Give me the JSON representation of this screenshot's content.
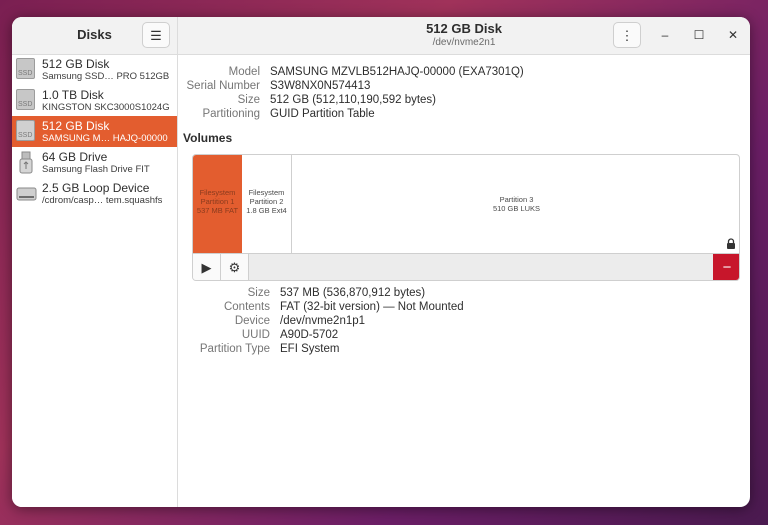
{
  "sidebar": {
    "title": "Disks",
    "devices": [
      {
        "name": "512 GB Disk",
        "sub": "Samsung SSD… PRO 512GB",
        "icon": "ssd-icon",
        "selected": false
      },
      {
        "name": "1.0 TB Disk",
        "sub": "KINGSTON SKC3000S1024G",
        "icon": "ssd-icon",
        "selected": false
      },
      {
        "name": "512 GB Disk",
        "sub": "SAMSUNG M… HAJQ-00000",
        "icon": "ssd-icon",
        "selected": true
      },
      {
        "name": "64 GB Drive",
        "sub": "Samsung Flash Drive FIT",
        "icon": "usb-drive-icon",
        "selected": false
      },
      {
        "name": "2.5 GB Loop Device",
        "sub": "/cdrom/casp… tem.squashfs",
        "icon": "loop-device-icon",
        "selected": false
      }
    ],
    "ssd_label": "SSD"
  },
  "header": {
    "title": "512 GB Disk",
    "subtitle": "/dev/nvme2n1"
  },
  "disk_info": {
    "model_label": "Model",
    "model": "SAMSUNG MZVLB512HAJQ-00000 (EXA7301Q)",
    "serial_label": "Serial Number",
    "serial": "S3W8NX0N574413",
    "size_label": "Size",
    "size": "512 GB (512,110,190,592 bytes)",
    "partitioning_label": "Partitioning",
    "partitioning": "GUID Partition Table"
  },
  "volumes": {
    "title": "Volumes",
    "partitions": [
      {
        "line1": "Filesystem",
        "line2": "Partition 1",
        "line3": "537 MB FAT"
      },
      {
        "line1": "Filesystem",
        "line2": "Partition 2",
        "line3": "1.8 GB Ext4"
      },
      {
        "line1": "Partition 3",
        "line2": "510 GB LUKS",
        "line3": ""
      }
    ]
  },
  "partition_info": {
    "size_label": "Size",
    "size": "537 MB (536,870,912 bytes)",
    "contents_label": "Contents",
    "contents": "FAT (32-bit version) — Not Mounted",
    "device_label": "Device",
    "device": "/dev/nvme2n1p1",
    "uuid_label": "UUID",
    "uuid": "A90D-5702",
    "type_label": "Partition Type",
    "type": "EFI System"
  },
  "colors": {
    "accent": "#e35d2f",
    "danger": "#c7162b"
  }
}
